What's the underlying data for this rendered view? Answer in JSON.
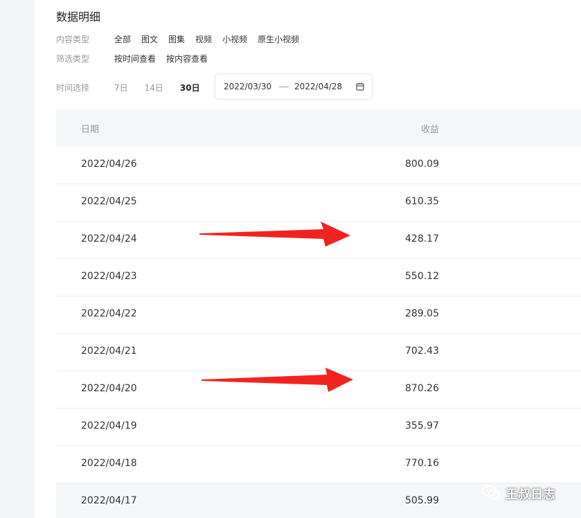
{
  "section_title": "数据明细",
  "content_filter": {
    "label": "内容类型",
    "options": [
      "全部",
      "图文",
      "图集",
      "视频",
      "小视频",
      "原生小视频"
    ]
  },
  "screen_filter": {
    "label": "筛选类型",
    "options": [
      "按时间查看",
      "按内容查看"
    ]
  },
  "time_filter": {
    "label": "时间选择",
    "options": [
      "7日",
      "14日",
      "30日"
    ],
    "selected": "30日"
  },
  "date_range": {
    "start": "2022/03/30",
    "end": "2022/04/28",
    "icon": "calendar-icon"
  },
  "table": {
    "columns": [
      "日期",
      "收益"
    ],
    "rows": [
      {
        "date": "2022/04/26",
        "income": "800.09"
      },
      {
        "date": "2022/04/25",
        "income": "610.35"
      },
      {
        "date": "2022/04/24",
        "income": "428.17"
      },
      {
        "date": "2022/04/23",
        "income": "550.12"
      },
      {
        "date": "2022/04/22",
        "income": "289.05"
      },
      {
        "date": "2022/04/21",
        "income": "702.43"
      },
      {
        "date": "2022/04/20",
        "income": "870.26"
      },
      {
        "date": "2022/04/19",
        "income": "355.97"
      },
      {
        "date": "2022/04/18",
        "income": "770.16"
      },
      {
        "date": "2022/04/17",
        "income": "505.99"
      }
    ]
  },
  "annotations": {
    "arrow_color": "#f2231f",
    "arrow_targets": [
      "2022/04/24",
      "2022/04/20"
    ]
  },
  "watermark": {
    "text": "王叔日志",
    "icon": "wechat-icon"
  }
}
